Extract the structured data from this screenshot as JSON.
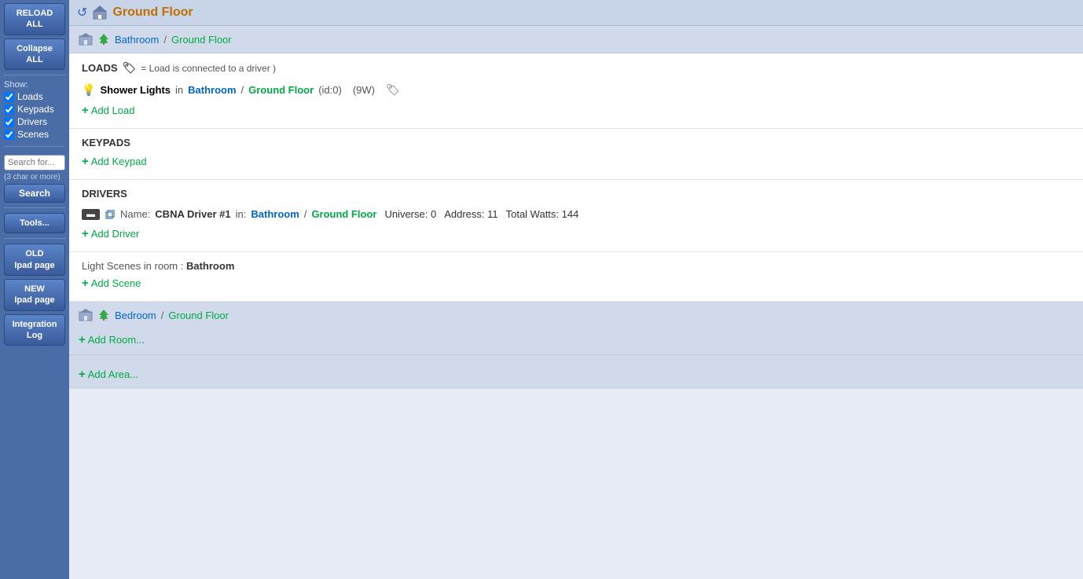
{
  "sidebar": {
    "reload_label": "RELOAD ALL",
    "collapse_label": "Collapse ALL",
    "show_label": "Show:",
    "checkboxes": [
      {
        "label": "Loads",
        "checked": true
      },
      {
        "label": "Keypads",
        "checked": true
      },
      {
        "label": "Drivers",
        "checked": true
      },
      {
        "label": "Scenes",
        "checked": true
      }
    ],
    "search_placeholder": "Search for...",
    "search_hint": "(3 char or more)",
    "search_btn": "Search",
    "tools_btn": "Tools...",
    "old_ipad_label1": "OLD",
    "old_ipad_label2": "Ipad page",
    "new_ipad_label1": "NEW",
    "new_ipad_label2": "Ipad page",
    "integration_label1": "Integration",
    "integration_label2": "Log"
  },
  "page": {
    "title": "Ground Floor",
    "rooms": [
      {
        "name": "Bathroom",
        "floor": "Ground Floor",
        "loads_section": {
          "title": "LOADS",
          "description": "= Load is connected to a driver",
          "items": [
            {
              "name": "Shower Lights",
              "in_text": "in",
              "room": "Bathroom",
              "slash": "/",
              "floor": "Ground Floor",
              "id_text": "(id:0)",
              "watts": "(9W)"
            }
          ],
          "add_label": "Add Load"
        },
        "keypads_section": {
          "title": "KEYPADS",
          "add_label": "Add Keypad"
        },
        "drivers_section": {
          "title": "DRIVERS",
          "items": [
            {
              "name_label": "Name:",
              "name": "CBNA Driver #1",
              "in_text": "in:",
              "room": "Bathroom",
              "slash": "/",
              "floor": "Ground Floor",
              "universe_label": "Universe:",
              "universe": "0",
              "address_label": "Address:",
              "address": "11",
              "watts_label": "Total Watts:",
              "watts": "144"
            }
          ],
          "add_label": "Add Driver"
        },
        "scenes_section": {
          "title_prefix": "Light Scenes in room :",
          "title_room": "Bathroom",
          "add_label": "Add Scene"
        }
      },
      {
        "name": "Bedroom",
        "floor": "Ground Floor"
      }
    ],
    "add_room_label": "Add Room...",
    "add_area_label": "Add Area..."
  }
}
